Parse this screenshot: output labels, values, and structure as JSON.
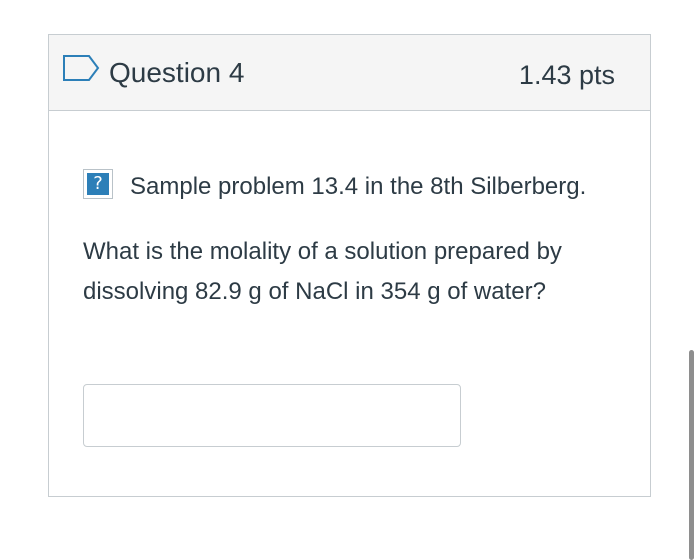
{
  "question": {
    "title": "Question 4",
    "points": "1.43 pts",
    "intro": "Sample problem 13.4 in the 8th Silberberg.",
    "text": "What is the molality of a solution prepared by dissolving 82.9 g of NaCl in 354 g of water?",
    "answer_value": "",
    "answer_placeholder": "",
    "help_icon_symbol": "?",
    "flag_icon": "flag-outline-icon"
  },
  "colors": {
    "header_background": "#f5f5f5",
    "border": "#c7cdd1",
    "text": "#2d3b45",
    "help_icon_fill": "#2c7fb8",
    "flag_outline": "#2c7fb8",
    "scrollbar": "#8e8e8e"
  }
}
